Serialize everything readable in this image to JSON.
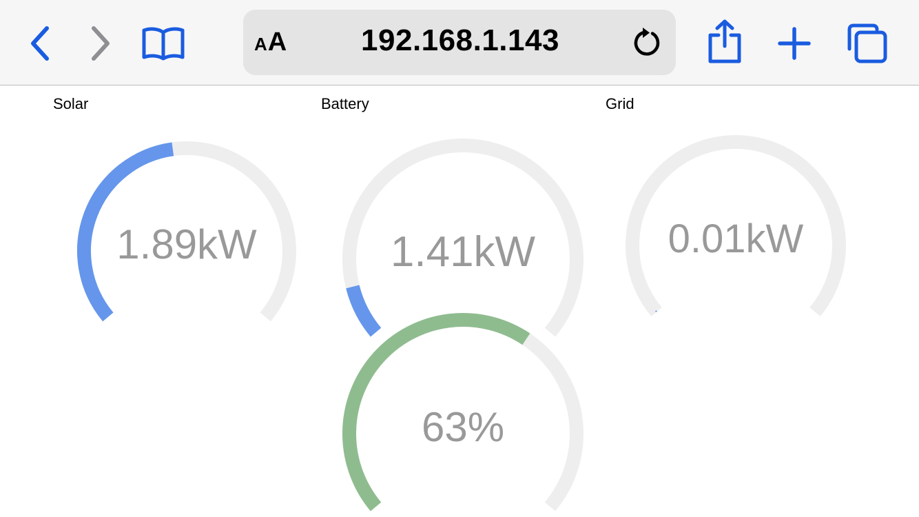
{
  "browser": {
    "address": "192.168.1.143",
    "reader_small": "A",
    "reader_big": "A",
    "icons": {
      "back": "chevron-left-icon",
      "forward": "chevron-right-icon",
      "bookmarks": "book-icon",
      "reload": "reload-icon",
      "share": "share-icon",
      "new_tab": "plus-icon",
      "tabs": "tabs-icon"
    },
    "accent_color": "#1a5ce0",
    "disabled_color": "#8e8e93"
  },
  "gauges": [
    {
      "id": "solar",
      "label": "Solar",
      "value_text": "1.89kW",
      "fill_fraction": 0.47,
      "color": "#6596eb"
    },
    {
      "id": "battery",
      "label": "Battery",
      "value_text": "1.41kW",
      "fill_fraction": 0.1,
      "color": "#6596eb"
    },
    {
      "id": "grid",
      "label": "Grid",
      "value_text": "0.01kW",
      "fill_fraction": 0.003,
      "color": "#6596eb"
    },
    {
      "id": "charge",
      "label": "",
      "value_text": "63%",
      "fill_fraction": 0.63,
      "color": "#8fbc8f"
    }
  ],
  "track_color": "#eeeeee",
  "value_text_color": "#999999"
}
